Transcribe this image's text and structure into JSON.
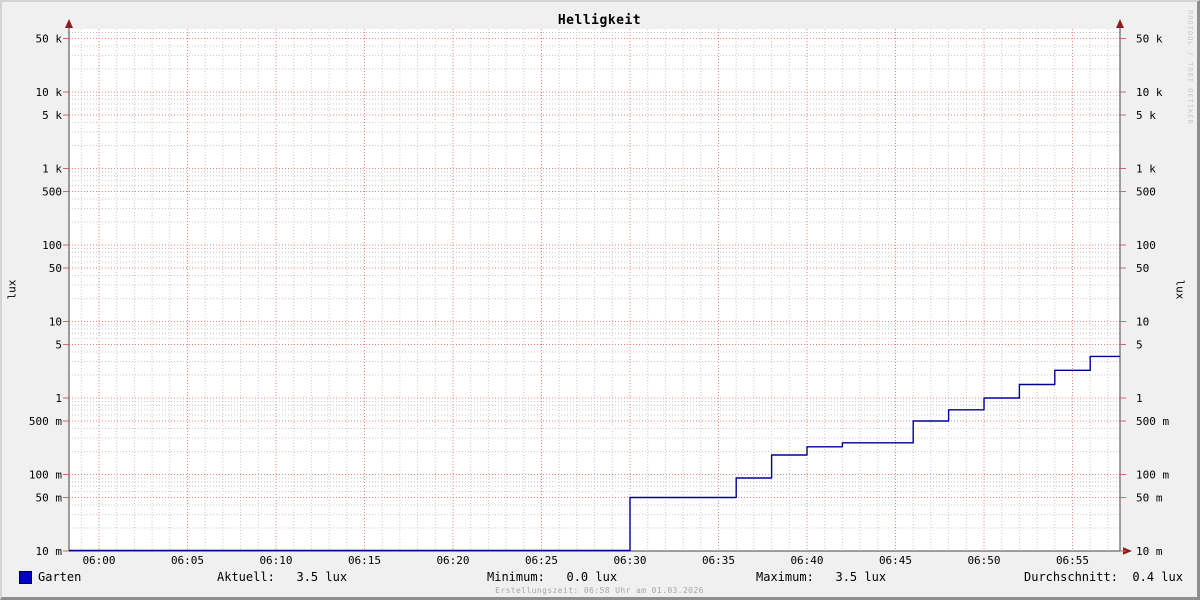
{
  "title": "Helligkeit",
  "watermark": "RRDTOOL / TOBI OETIKER",
  "footer": "Erstellungszeit: 06:58 Uhr am 01.03.2026",
  "axis": {
    "left_label": "lux",
    "right_label": "lux"
  },
  "legend": {
    "label": "Garten",
    "swatch_color": "#0000cc"
  },
  "stats_display": {
    "aktuell": "Aktuell:   3.5 lux",
    "minimum": "Minimum:   0.0 lux",
    "maximum": "Maximum:   3.5 lux",
    "durchschnitt": "Durchschnitt:  0.4 lux"
  },
  "chart_data": {
    "type": "line",
    "style": "step",
    "title": "Helligkeit",
    "ylabel": "lux",
    "y_scale": "log",
    "ylim": [
      0.01,
      66000
    ],
    "x_window": [
      "05:58",
      "06:58"
    ],
    "grid": true,
    "legend_position": "bottom-left",
    "colors": {
      "series_line": "#000099",
      "major_grid": "#f08080",
      "minor_grid": "#c9c9c9",
      "axis": "#444444",
      "arrow": "#8f1d1d"
    },
    "y_ticks": [
      {
        "label": "50 k",
        "value": 50000
      },
      {
        "label": "10 k",
        "value": 10000
      },
      {
        "label": "5 k",
        "value": 5000
      },
      {
        "label": "1 k",
        "value": 1000
      },
      {
        "label": "500",
        "value": 500
      },
      {
        "label": "100",
        "value": 100
      },
      {
        "label": "50",
        "value": 50
      },
      {
        "label": "10",
        "value": 10
      },
      {
        "label": "5",
        "value": 5
      },
      {
        "label": "1",
        "value": 1
      },
      {
        "label": "500 m",
        "value": 0.5
      },
      {
        "label": "100 m",
        "value": 0.1
      },
      {
        "label": "50 m",
        "value": 0.05
      },
      {
        "label": "10 m",
        "value": 0.01
      }
    ],
    "x_ticks": [
      {
        "label": "06:00",
        "minute": 0
      },
      {
        "label": "06:05",
        "minute": 5
      },
      {
        "label": "06:10",
        "minute": 10
      },
      {
        "label": "06:15",
        "minute": 15
      },
      {
        "label": "06:20",
        "minute": 20
      },
      {
        "label": "06:25",
        "minute": 25
      },
      {
        "label": "06:30",
        "minute": 30
      },
      {
        "label": "06:35",
        "minute": 35
      },
      {
        "label": "06:40",
        "minute": 40
      },
      {
        "label": "06:45",
        "minute": 45
      },
      {
        "label": "06:50",
        "minute": 50
      },
      {
        "label": "06:55",
        "minute": 55
      }
    ],
    "minor_x_step_minutes": 1,
    "series": [
      {
        "name": "Garten",
        "color": "#000099",
        "unit": "lux",
        "points": [
          [
            "05:58",
            0.0
          ],
          [
            "06:30",
            0.0
          ],
          [
            "06:30",
            0.05
          ],
          [
            "06:36",
            0.05
          ],
          [
            "06:36",
            0.09
          ],
          [
            "06:38",
            0.09
          ],
          [
            "06:38",
            0.18
          ],
          [
            "06:40",
            0.18
          ],
          [
            "06:40",
            0.23
          ],
          [
            "06:42",
            0.23
          ],
          [
            "06:42",
            0.26
          ],
          [
            "06:46",
            0.26
          ],
          [
            "06:46",
            0.5
          ],
          [
            "06:48",
            0.5
          ],
          [
            "06:48",
            0.7
          ],
          [
            "06:50",
            0.7
          ],
          [
            "06:50",
            1.0
          ],
          [
            "06:52",
            1.0
          ],
          [
            "06:52",
            1.5
          ],
          [
            "06:54",
            1.5
          ],
          [
            "06:54",
            2.3
          ],
          [
            "06:56",
            2.3
          ],
          [
            "06:56",
            3.5
          ],
          [
            "06:58",
            3.5
          ]
        ]
      }
    ],
    "summary": {
      "aktuell": 3.5,
      "minimum": 0.0,
      "maximum": 3.5,
      "durchschnitt": 0.4,
      "unit": "lux"
    }
  }
}
